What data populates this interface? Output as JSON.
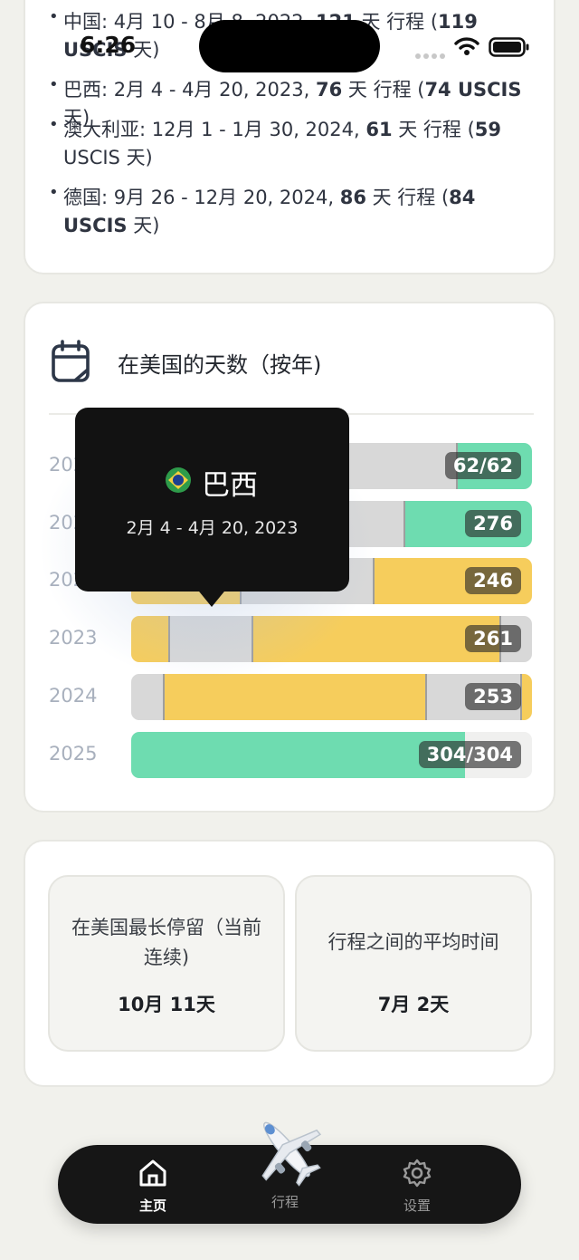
{
  "status_bar": {
    "time": "6:26"
  },
  "trips": [
    {
      "pre": "中国: 4月 10 - 8月 8, 2022, ",
      "trip_days": "121",
      "mid": " 天 行程 (",
      "uscis_days": "119 USCIS",
      "post": " 天)"
    },
    {
      "pre": "巴西: 2月 4 - 4月 20, 2023, ",
      "trip_days": "76",
      "mid": " 天 行程 (",
      "uscis_days": "74 USCIS",
      "post": " 天)"
    },
    {
      "pre": "澳大利亚: 12月 1 - 1月 30, 2024, ",
      "trip_days": "61",
      "mid": " 天 行程 (",
      "uscis_days": "59",
      "post": " USCIS 天)"
    },
    {
      "pre": "德国: 9月 26 - 12月 20, 2024, ",
      "trip_days": "86",
      "mid": " 天 行程 (",
      "uscis_days": "84 USCIS",
      "post": " 天)"
    }
  ],
  "chart_section": {
    "title": "在美国的天数（按年)",
    "icon": "calendar-icon"
  },
  "chart_data": {
    "type": "bar",
    "title": "在美国的天数（按年)",
    "categories": [
      "2020",
      "2021",
      "2022",
      "2023",
      "2024",
      "2025"
    ],
    "values": [
      62,
      276,
      246,
      261,
      253,
      304
    ],
    "value_labels": [
      "62/62",
      "276",
      "246",
      "261",
      "253",
      "304/304"
    ],
    "colors": {
      "in_us": "#6edcb0",
      "trip": "#f6cd5c",
      "abroad": "#d8d8d8",
      "empty": "#f0f0ef"
    },
    "bars": [
      {
        "year": "2020",
        "segments": [
          {
            "kind": "abroad",
            "days": 268
          },
          {
            "kind": "in_us",
            "days": 62
          }
        ]
      },
      {
        "year": "2021",
        "segments": [
          {
            "kind": "abroad",
            "days": 226
          },
          {
            "kind": "in_us",
            "days": 106
          }
        ]
      },
      {
        "year": "2022",
        "segments": [
          {
            "kind": "trip",
            "days": 100
          },
          {
            "kind": "abroad",
            "days": 121
          },
          {
            "kind": "trip",
            "days": 144
          }
        ]
      },
      {
        "year": "2023",
        "segments": [
          {
            "kind": "trip",
            "days": 35
          },
          {
            "kind": "abroad",
            "days": 76
          },
          {
            "kind": "trip",
            "days": 226
          },
          {
            "kind": "abroad",
            "days": 29
          }
        ]
      },
      {
        "year": "2024",
        "segments": [
          {
            "kind": "abroad",
            "days": 30
          },
          {
            "kind": "trip",
            "days": 239
          },
          {
            "kind": "abroad",
            "days": 86
          },
          {
            "kind": "trip",
            "days": 10
          }
        ]
      },
      {
        "year": "2025",
        "segments": [
          {
            "kind": "in_us",
            "days": 304
          },
          {
            "kind": "empty",
            "days": 61
          }
        ]
      }
    ],
    "tooltip": {
      "country": "巴西",
      "dates": "2月 4 - 4月 20, 2023",
      "flag": "brazil-flag-icon"
    }
  },
  "stats": [
    {
      "label": "在美国最长停留（当前连续)",
      "value": "10月 11天"
    },
    {
      "label": "行程之间的平均时间",
      "value": "7月 2天"
    }
  ],
  "tab_bar": {
    "tabs": [
      {
        "label": "主页",
        "icon": "home-icon",
        "active": true
      },
      {
        "label": "行程",
        "icon": "airplane-icon",
        "active": false
      },
      {
        "label": "设置",
        "icon": "gear-icon",
        "active": false
      }
    ]
  }
}
